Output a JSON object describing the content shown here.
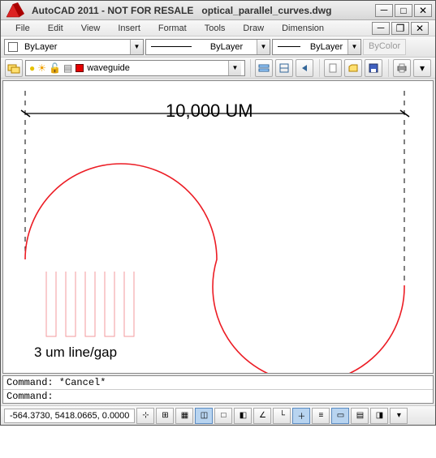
{
  "window": {
    "app_title": "AutoCAD 2011 - NOT FOR RESALE",
    "file_name": "optical_parallel_curves.dwg"
  },
  "menu": {
    "file": "File",
    "edit": "Edit",
    "view": "View",
    "insert": "Insert",
    "format": "Format",
    "tools": "Tools",
    "draw": "Draw",
    "dimension": "Dimension"
  },
  "props": {
    "color_label": "ByLayer",
    "linetype_label": "ByLayer",
    "lineweight_label": "ByLayer",
    "plotstyle_label": "ByColor",
    "current_layer": "waveguide",
    "layer_color_hex": "#e60000"
  },
  "drawing": {
    "dimension_text": "10,000 UM",
    "note_text": "3 um line/gap",
    "curve_color": "#ec1c24",
    "grating_color": "#f39a9d"
  },
  "command": {
    "history_line": "Command: *Cancel*",
    "prompt_label": "Command:",
    "input_value": ""
  },
  "status": {
    "coords": "-564.3730, 5418.0665, 0.0000"
  },
  "icons": {
    "minimize": "minimize-icon",
    "maximize": "maximize-icon",
    "close": "close-icon",
    "layer_props": "layer-properties-icon",
    "layer_states": "layer-states-icon",
    "layer_iso": "layer-iso-icon",
    "layer_prev": "layer-previous-icon",
    "new_file": "new-file-icon",
    "open_file": "open-file-icon",
    "save_file": "save-file-icon",
    "print": "print-icon",
    "plotstyle_dd": "plotstyle-dropdown-icon",
    "bulb": "lightbulb-icon",
    "sun": "sun-icon",
    "lock": "unlock-icon",
    "plot": "plottable-icon",
    "chevron": "chevron-down-icon"
  }
}
